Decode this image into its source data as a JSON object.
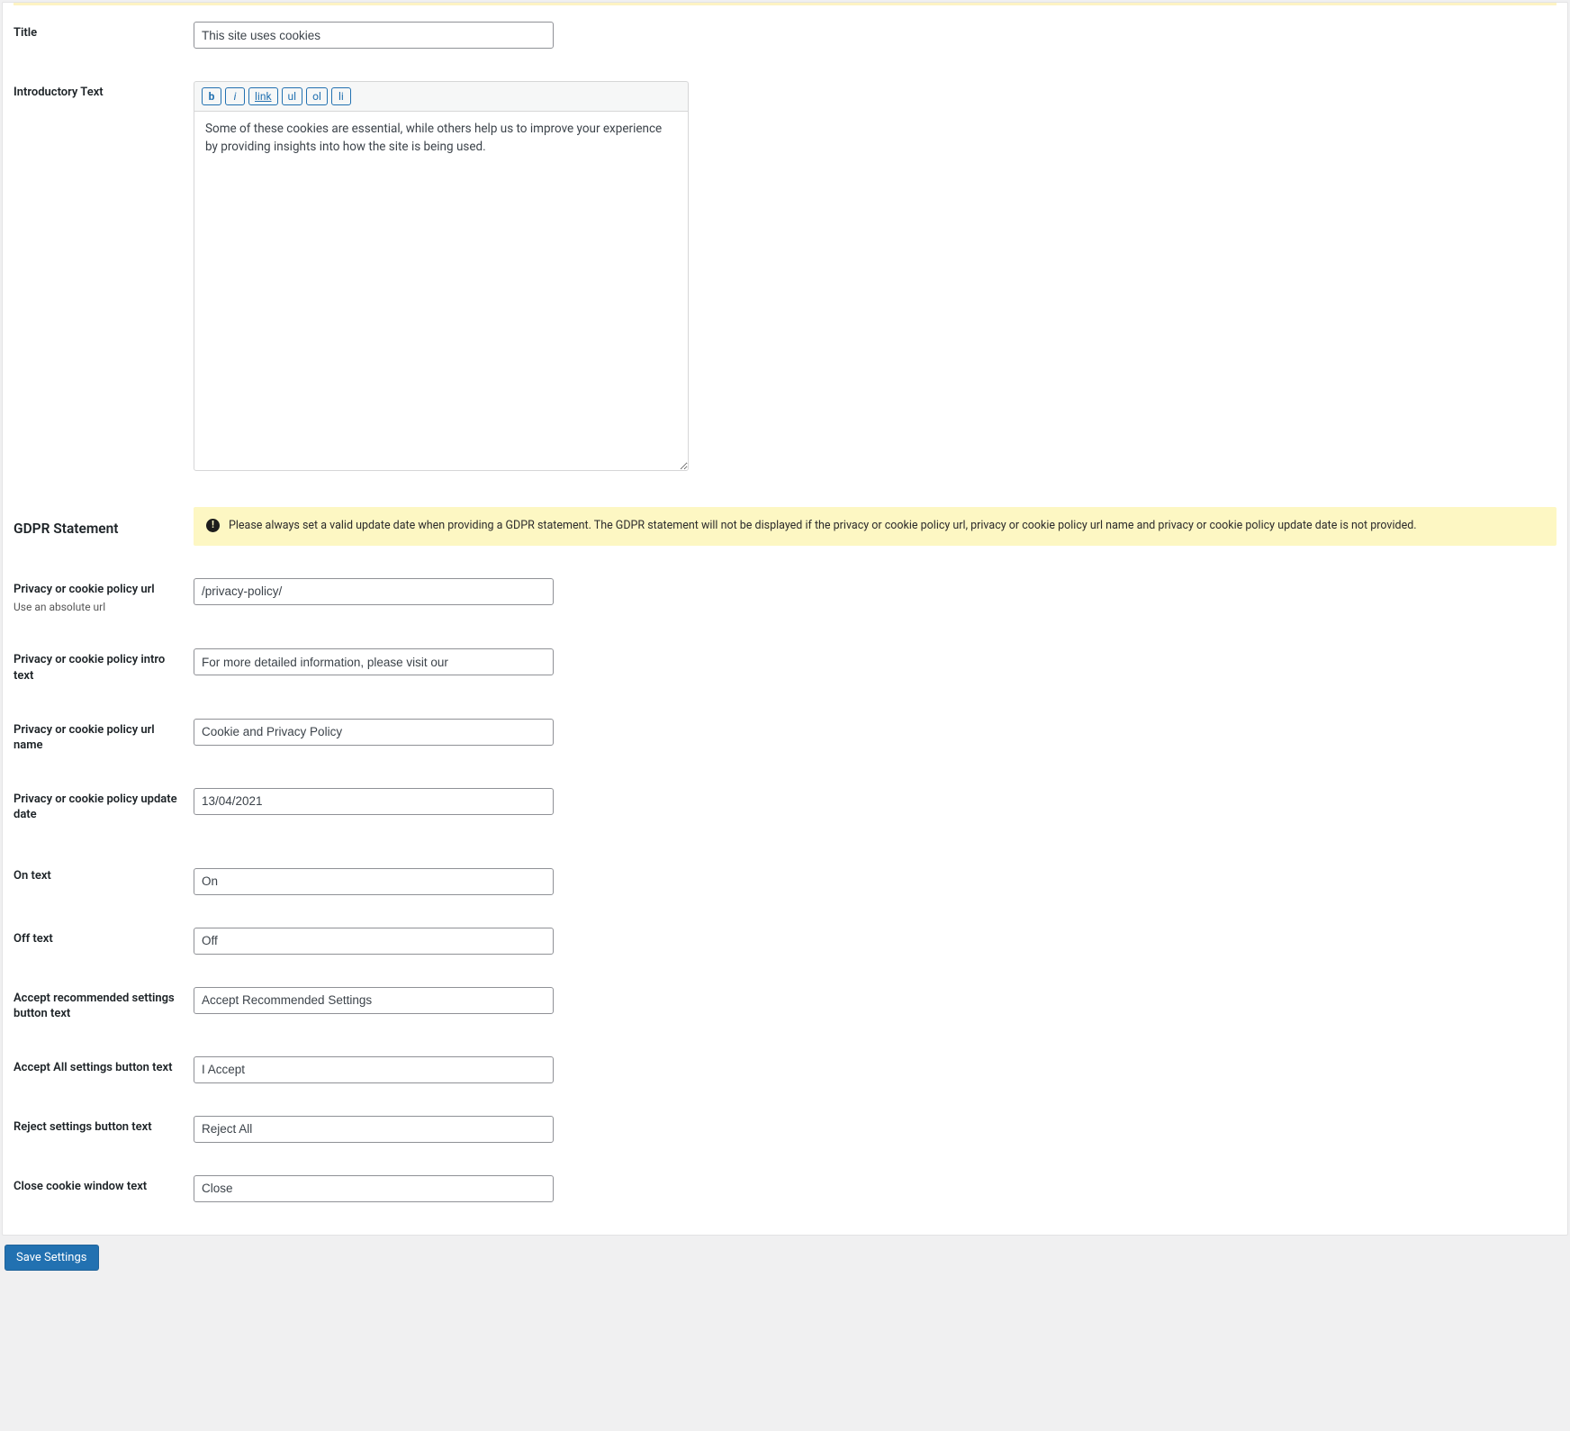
{
  "fields": {
    "title": {
      "label": "Title",
      "value": "This site uses cookies"
    },
    "intro": {
      "label": "Introductory Text",
      "value": "Some of these cookies are essential, while others help us to improve your experience by providing insights into how the site is being used."
    },
    "gdpr_heading": "GDPR Statement",
    "gdpr_notice": "Please always set a valid update date when providing a GDPR statement. The GDPR statement will not be displayed if the privacy or cookie policy url, privacy or cookie policy url name and privacy or cookie policy update date is not provided.",
    "policy_url": {
      "label": "Privacy or cookie policy url",
      "hint": "Use an absolute url",
      "value": "/privacy-policy/"
    },
    "policy_intro": {
      "label": "Privacy or cookie policy intro text",
      "value": "For more detailed information, please visit our"
    },
    "policy_url_name": {
      "label": "Privacy or cookie policy url name",
      "value": "Cookie and Privacy Policy"
    },
    "policy_update_date": {
      "label": "Privacy or cookie policy update date",
      "value": "13/04/2021"
    },
    "on_text": {
      "label": "On text",
      "value": "On"
    },
    "off_text": {
      "label": "Off text",
      "value": "Off"
    },
    "accept_recommended": {
      "label": "Accept recommended settings button text",
      "value": "Accept Recommended Settings"
    },
    "accept_all": {
      "label": "Accept All settings button text",
      "value": "I Accept"
    },
    "reject": {
      "label": "Reject settings button text",
      "value": "Reject All"
    },
    "close": {
      "label": "Close cookie window text",
      "value": "Close"
    }
  },
  "editor_buttons": {
    "b": "b",
    "i": "i",
    "link": "link",
    "ul": "ul",
    "ol": "ol",
    "li": "li"
  },
  "actions": {
    "save": "Save Settings"
  },
  "notice_icon_glyph": "!"
}
